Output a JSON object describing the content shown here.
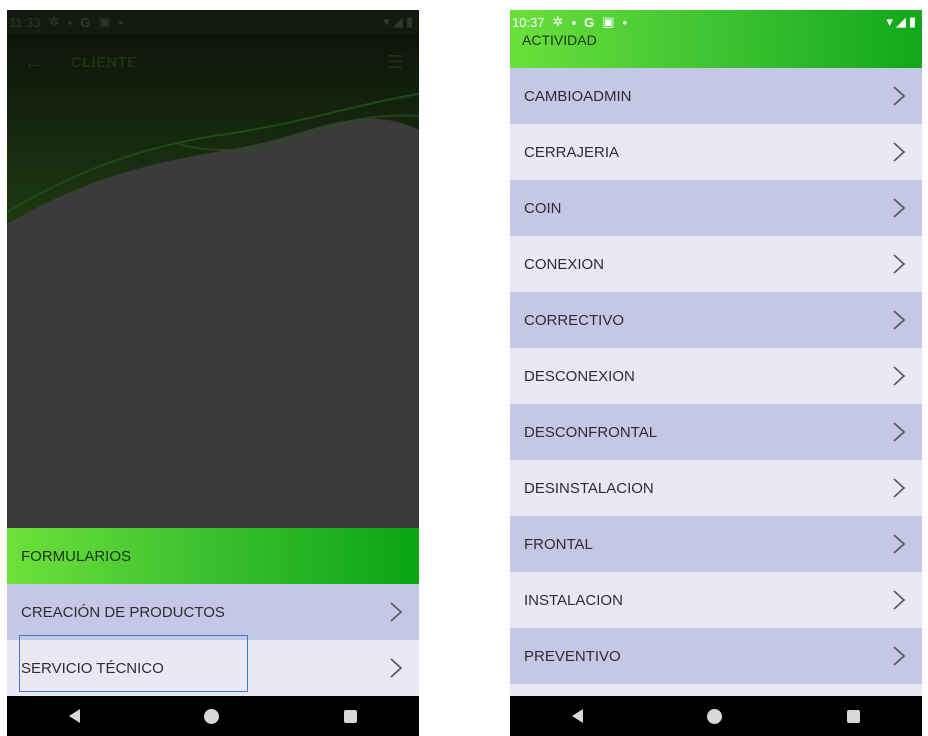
{
  "left_screen": {
    "status": {
      "time": "11:33"
    },
    "toolbar": {
      "title": "CLIENTE"
    },
    "section_header": "FORMULARIOS",
    "items": [
      {
        "label": "CREACIÓN DE PRODUCTOS"
      },
      {
        "label": "SERVICIO TÉCNICO",
        "focused": true
      }
    ]
  },
  "right_screen": {
    "status": {
      "time": "10:37"
    },
    "header": "ACTIVIDAD",
    "items": [
      {
        "label": "CAMBIOADMIN"
      },
      {
        "label": "CERRAJERIA"
      },
      {
        "label": "COIN"
      },
      {
        "label": "CONEXION"
      },
      {
        "label": "CORRECTIVO"
      },
      {
        "label": "DESCONEXION"
      },
      {
        "label": "DESCONFRONTAL"
      },
      {
        "label": "DESINSTALACION"
      },
      {
        "label": "FRONTAL"
      },
      {
        "label": "INSTALACION"
      },
      {
        "label": "PREVENTIVO"
      }
    ]
  },
  "icons": {
    "back": "arrow-left-icon",
    "menu": "menu-collapse-icon",
    "chevron": "chevron-right-icon",
    "status_left": [
      "settings-icon",
      "notification-icon",
      "google-icon",
      "gallery-icon",
      "dot-icon"
    ],
    "status_right": [
      "wifi-icon",
      "signal-icon",
      "battery-icon"
    ]
  },
  "colors": {
    "accent_green": "#3fc230",
    "row_dark": "#c5c7e6",
    "row_light": "#e8e9f5",
    "focus_border": "#3a7fd5"
  }
}
